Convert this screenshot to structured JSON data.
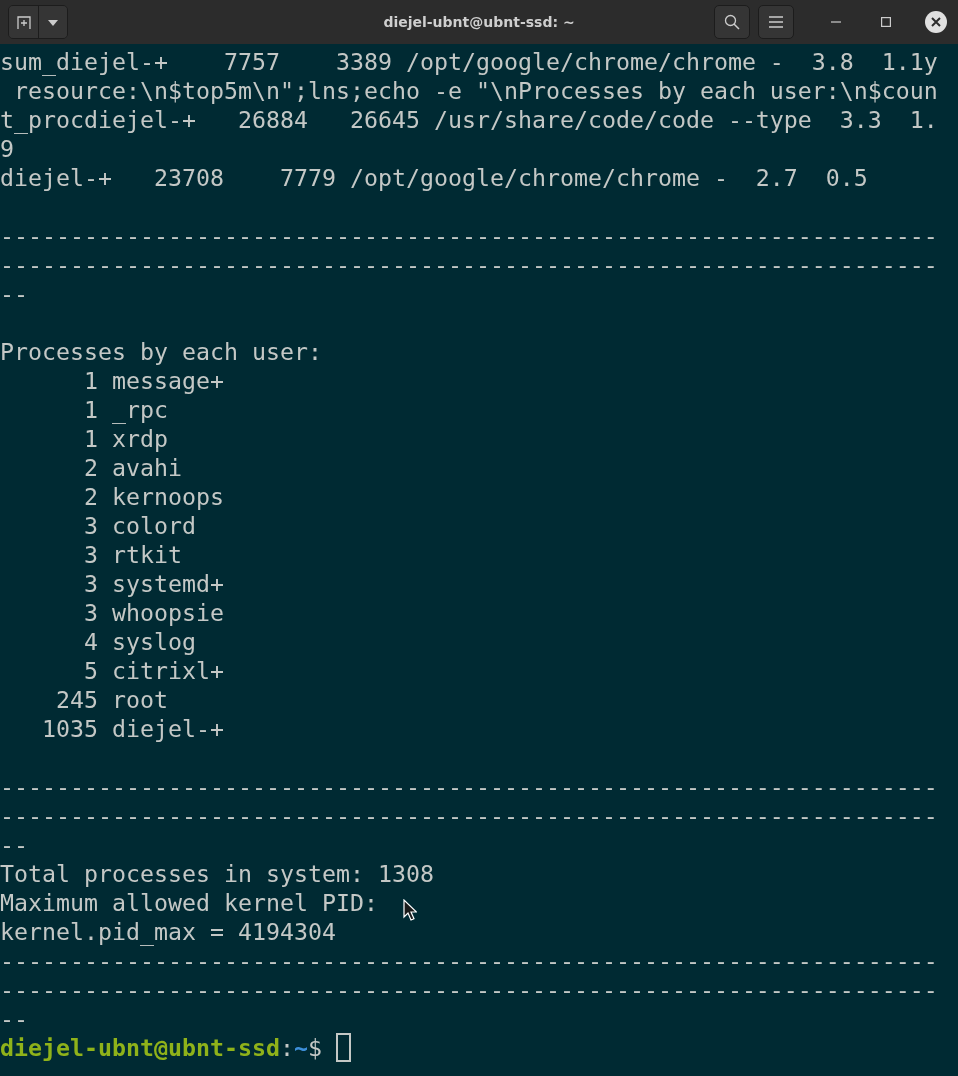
{
  "window": {
    "title": "diejel-ubnt@ubnt-ssd: ~"
  },
  "blocks": [
    [
      "sum_diejel-+    7757    3389 /opt/google/chrome/chrome -  3.8  1.1y",
      " resource:\\n$top5m\\n\";lns;echo -e \"\\nProcesses by each user:\\n$coun",
      "t_procdiejel-+   26884   26645 /usr/share/code/code --type  3.3  1.",
      "9",
      "diejel-+   23708    7779 /opt/google/chrome/chrome -  2.7  0.5"
    ],
    [
      "-------------------------------------------------------------------",
      "-------------------------------------------------------------------",
      "--"
    ],
    [
      "Processes by each user:",
      "      1 message+",
      "      1 _rpc",
      "      1 xrdp",
      "      2 avahi",
      "      2 kernoops",
      "      3 colord",
      "      3 rtkit",
      "      3 systemd+",
      "      3 whoopsie",
      "      4 syslog",
      "      5 citrixl+",
      "    245 root",
      "   1035 diejel-+"
    ],
    [
      "-------------------------------------------------------------------",
      "-------------------------------------------------------------------",
      "--",
      "Total processes in system: 1308",
      "Maximum allowed kernel PID:",
      "kernel.pid_max = 4194304",
      "-------------------------------------------------------------------",
      "-------------------------------------------------------------------",
      "--"
    ]
  ],
  "prompt": {
    "user_host": "diejel-ubnt@ubnt-ssd",
    "separator": ":",
    "path": "~",
    "symbol": "$"
  }
}
